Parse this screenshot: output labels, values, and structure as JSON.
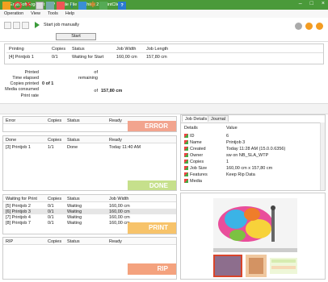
{
  "window": {
    "title": "ErgoSoft Ergosoft USP Single File Machine 2 - PrintClient"
  },
  "menu": [
    "Operation",
    "View",
    "Tools",
    "Help"
  ],
  "toolbar": {
    "start_manual_label": "Start job manually",
    "start_button": "Start"
  },
  "current_job": {
    "headers": [
      "Printing",
      "Copies",
      "Status",
      "Job Width",
      "Job Length"
    ],
    "row": [
      "[4]  Printjob 1",
      "0/1",
      "Waiting for Start",
      "160,00 cm",
      "157,80 cm"
    ]
  },
  "stats": {
    "printed_label": "Printed",
    "of_label": "of",
    "time_elapsed_label": "Time elapsed",
    "remaining_label": "remaining",
    "copies_printed_label": "Copies printed",
    "copies_printed_value": "0 of 1",
    "media_consumed_label": "Media consumed",
    "media_of_label": "of",
    "media_value": "157,80 cm",
    "print_rate_label": "Print rate"
  },
  "error_panel": {
    "headers": [
      "Error",
      "Copies",
      "Status",
      "Ready"
    ],
    "watermark": "ERROR"
  },
  "done_panel": {
    "headers": [
      "Done",
      "Copies",
      "Status",
      "Ready"
    ],
    "rows": [
      [
        "[3]  Printjob 1",
        "1/1",
        "Done",
        "Today 11:40 AM"
      ]
    ],
    "watermark": "DONE"
  },
  "waiting_panel": {
    "headers": [
      "Waiting for Print",
      "Copies",
      "Status",
      "Job Width"
    ],
    "rows": [
      [
        "[5]  Printjob 2",
        "0/1",
        "Waiting",
        "160,00 cm"
      ],
      [
        "[6]  Printjob 3",
        "0/1",
        "Waiting",
        "160,00 cm"
      ],
      [
        "[7]  Printjob 4",
        "0/1",
        "Waiting",
        "160,00 cm"
      ],
      [
        "[8]  Printjob 7",
        "0/1",
        "Waiting",
        "160,00 cm"
      ]
    ],
    "watermark": "PRINT"
  },
  "rip_panel": {
    "headers": [
      "RIP",
      "Copies",
      "Status",
      "Ready"
    ],
    "watermark": "RIP"
  },
  "details": {
    "tabs": [
      "Job Details",
      "Journal"
    ],
    "headers": [
      "Details",
      "Value"
    ],
    "rows": [
      [
        "ID",
        "6"
      ],
      [
        "Name",
        "Printjob 3"
      ],
      [
        "Created",
        "Today 11:28 AM (15.0.0.6356)"
      ],
      [
        "Owner",
        "sw  on NB_SLA_WTP"
      ],
      [
        "Copies",
        "1"
      ],
      [
        "Job Size",
        "160,00 cm x 157,80 cm"
      ],
      [
        "Features",
        "Keep Rip Data"
      ],
      [
        "Media",
        ""
      ]
    ]
  },
  "colors": {
    "titlebar": "#4a9a3a",
    "error": "#f2a48e",
    "done": "#c6e08c",
    "print": "#f7c36a",
    "rip": "#f4a27e",
    "dot_gray": "#aaaaaa",
    "dot_orange": "#f39c22"
  }
}
